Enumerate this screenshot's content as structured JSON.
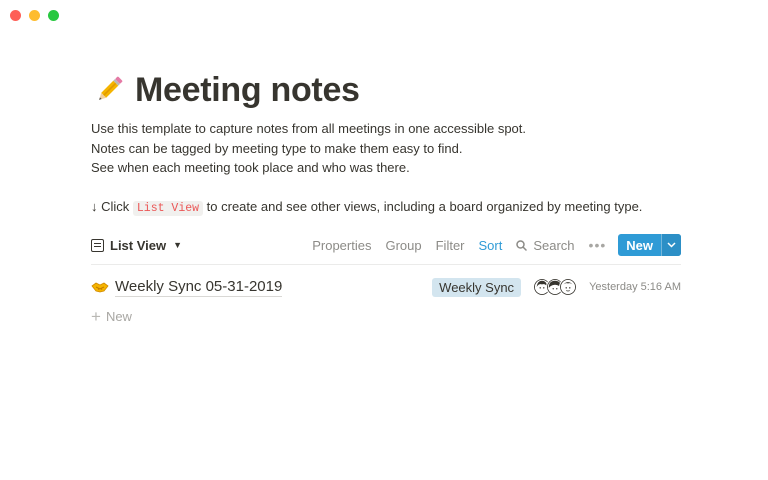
{
  "window": {
    "controls": [
      "close",
      "minimize",
      "maximize"
    ]
  },
  "page": {
    "icon": "pencil-icon",
    "title": "Meeting notes",
    "description": [
      "Use this template to capture notes from all meetings in one accessible spot.",
      "Notes can be tagged by meeting type to make them easy to find.",
      "See when each meeting took place and who was there."
    ],
    "hint": {
      "arrow": "↓ Click",
      "code": "List View",
      "rest": "to create and see other views, including a board organized by meeting type."
    }
  },
  "toolbar": {
    "view_label": "List View",
    "properties": "Properties",
    "group": "Group",
    "filter": "Filter",
    "sort": "Sort",
    "search": "Search",
    "more": "•••",
    "new_label": "New"
  },
  "rows": [
    {
      "icon": "handshake-icon",
      "title": "Weekly Sync 05-31-2019",
      "tag": "Weekly Sync",
      "tag_color": "#d3e5ef",
      "participants": [
        "avatar-1",
        "avatar-2",
        "avatar-3"
      ],
      "timestamp": "Yesterday 5:16 AM"
    }
  ],
  "add_new_label": "New",
  "colors": {
    "accent": "#2f9bd6",
    "code_text": "#eb5757"
  }
}
